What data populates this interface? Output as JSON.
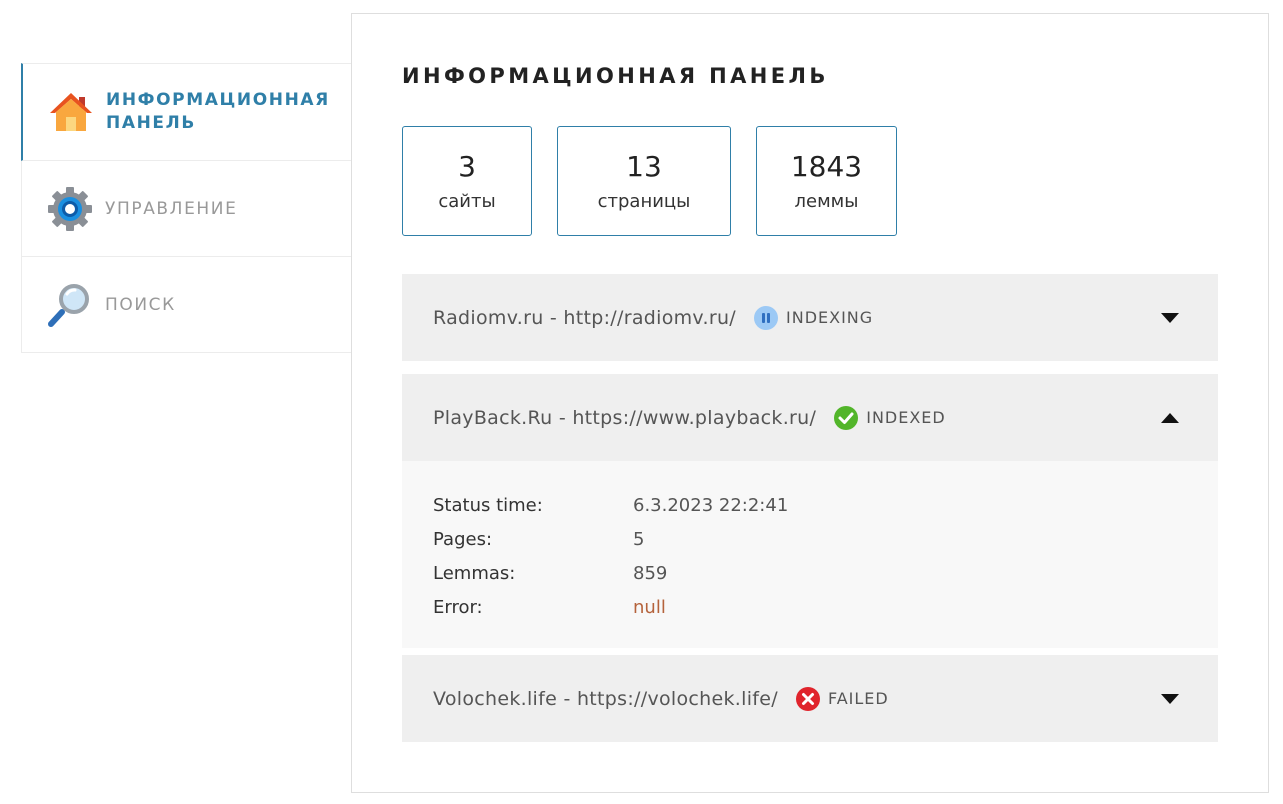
{
  "sidebar": {
    "items": [
      {
        "label": "ИНФОРМАЦИОННАЯ ПАНЕЛЬ",
        "icon": "home-icon",
        "active": true
      },
      {
        "label": "УПРАВЛЕНИЕ",
        "icon": "gear-icon",
        "active": false
      },
      {
        "label": "ПОИСК",
        "icon": "magnifier-icon",
        "active": false
      }
    ]
  },
  "main": {
    "title": "ИНФОРМАЦИОННАЯ ПАНЕЛЬ",
    "stats": [
      {
        "value": "3",
        "caption": "сайты"
      },
      {
        "value": "13",
        "caption": "страницы"
      },
      {
        "value": "1843",
        "caption": "леммы"
      }
    ],
    "sites": [
      {
        "name": "Radiomv.ru - http://radiomv.ru/",
        "status": "INDEXING",
        "status_icon": "pause-icon",
        "expanded": false
      },
      {
        "name": "PlayBack.Ru - https://www.playback.ru/",
        "status": "INDEXED",
        "status_icon": "check-icon",
        "expanded": true,
        "details": [
          {
            "key": "Status time:",
            "value": "6.3.2023 22:2:41"
          },
          {
            "key": "Pages:",
            "value": "5"
          },
          {
            "key": "Lemmas:",
            "value": "859"
          },
          {
            "key": "Error:",
            "value": "null"
          }
        ]
      },
      {
        "name": "Volochek.life - https://volochek.life/",
        "status": "FAILED",
        "status_icon": "x-icon",
        "expanded": false
      }
    ]
  },
  "colors": {
    "accent": "#2f7fa8",
    "indexing": "#7fb8f0",
    "indexed": "#4caf24",
    "failed": "#e0242c",
    "error_value": "#b5633c"
  }
}
